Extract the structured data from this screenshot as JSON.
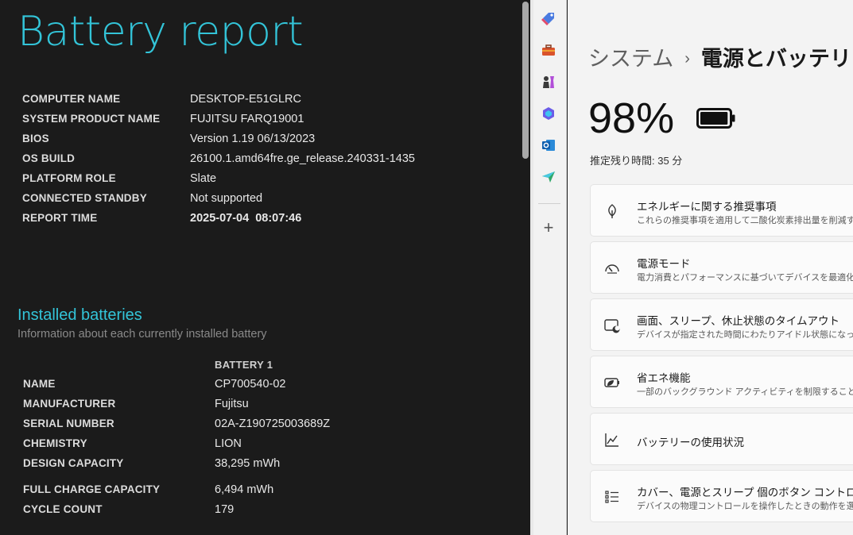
{
  "report": {
    "title": "Battery report",
    "system_info": [
      {
        "key": "COMPUTER NAME",
        "value": "DESKTOP-E51GLRC"
      },
      {
        "key": "SYSTEM PRODUCT NAME",
        "value": "FUJITSU FARQ19001"
      },
      {
        "key": "BIOS",
        "value": "Version 1.19 06/13/2023"
      },
      {
        "key": "OS BUILD",
        "value": "26100.1.amd64fre.ge_release.240331-1435"
      },
      {
        "key": "PLATFORM ROLE",
        "value": "Slate"
      },
      {
        "key": "CONNECTED STANDBY",
        "value": "Not supported"
      },
      {
        "key": "REPORT TIME",
        "value": "2025-07-04  08:07:46"
      }
    ],
    "installed_batteries": {
      "title": "Installed batteries",
      "subtitle": "Information about each currently installed battery",
      "column_header": "BATTERY 1",
      "rows": [
        {
          "key": "NAME",
          "value": "CP700540-02"
        },
        {
          "key": "MANUFACTURER",
          "value": "Fujitsu"
        },
        {
          "key": "SERIAL NUMBER",
          "value": "02A-Z190725003689Z"
        },
        {
          "key": "CHEMISTRY",
          "value": "LION"
        },
        {
          "key": "DESIGN CAPACITY",
          "value": "38,295 mWh"
        },
        {
          "key": "FULL CHARGE CAPACITY",
          "value": "6,494 mWh"
        },
        {
          "key": "CYCLE COUNT",
          "value": "179"
        }
      ]
    }
  },
  "sidebar": {
    "icons": [
      "tag-icon",
      "toolbox-icon",
      "chess-icon",
      "copilot-icon",
      "outlook-icon",
      "send-icon"
    ],
    "plus_label": "+"
  },
  "settings": {
    "breadcrumb_parent": "システム",
    "breadcrumb_separator": "›",
    "breadcrumb_current": "電源とバッテリー",
    "battery_percent": "98%",
    "battery_level": 0.98,
    "remaining_time": "推定残り時間: 35 分",
    "cards": [
      {
        "icon": "leaf-icon",
        "title": "エネルギーに関する推奨事項",
        "subtitle": "これらの推奨事項を適用して二酸化炭素排出量を削減す"
      },
      {
        "icon": "gauge-icon",
        "title": "電源モード",
        "subtitle": "電力消費とパフォーマンスに基づいてデバイスを最適化"
      },
      {
        "icon": "sleep-icon",
        "title": "画面、スリープ、休止状態のタイムアウト",
        "subtitle": "デバイスが指定された時間にわたりアイドル状態になった場合"
      },
      {
        "icon": "battery-saver-icon",
        "title": "省エネ機能",
        "subtitle": "一部のバックグラウンド アクティビティを制限することで、電力"
      },
      {
        "icon": "chart-icon",
        "title": "バッテリーの使用状況",
        "subtitle": ""
      },
      {
        "icon": "list-icon",
        "title": "カバー、電源とスリープ 個のボタン コントロール",
        "subtitle": "デバイスの物理コントロールを操作したときの動作を選択し"
      }
    ]
  }
}
